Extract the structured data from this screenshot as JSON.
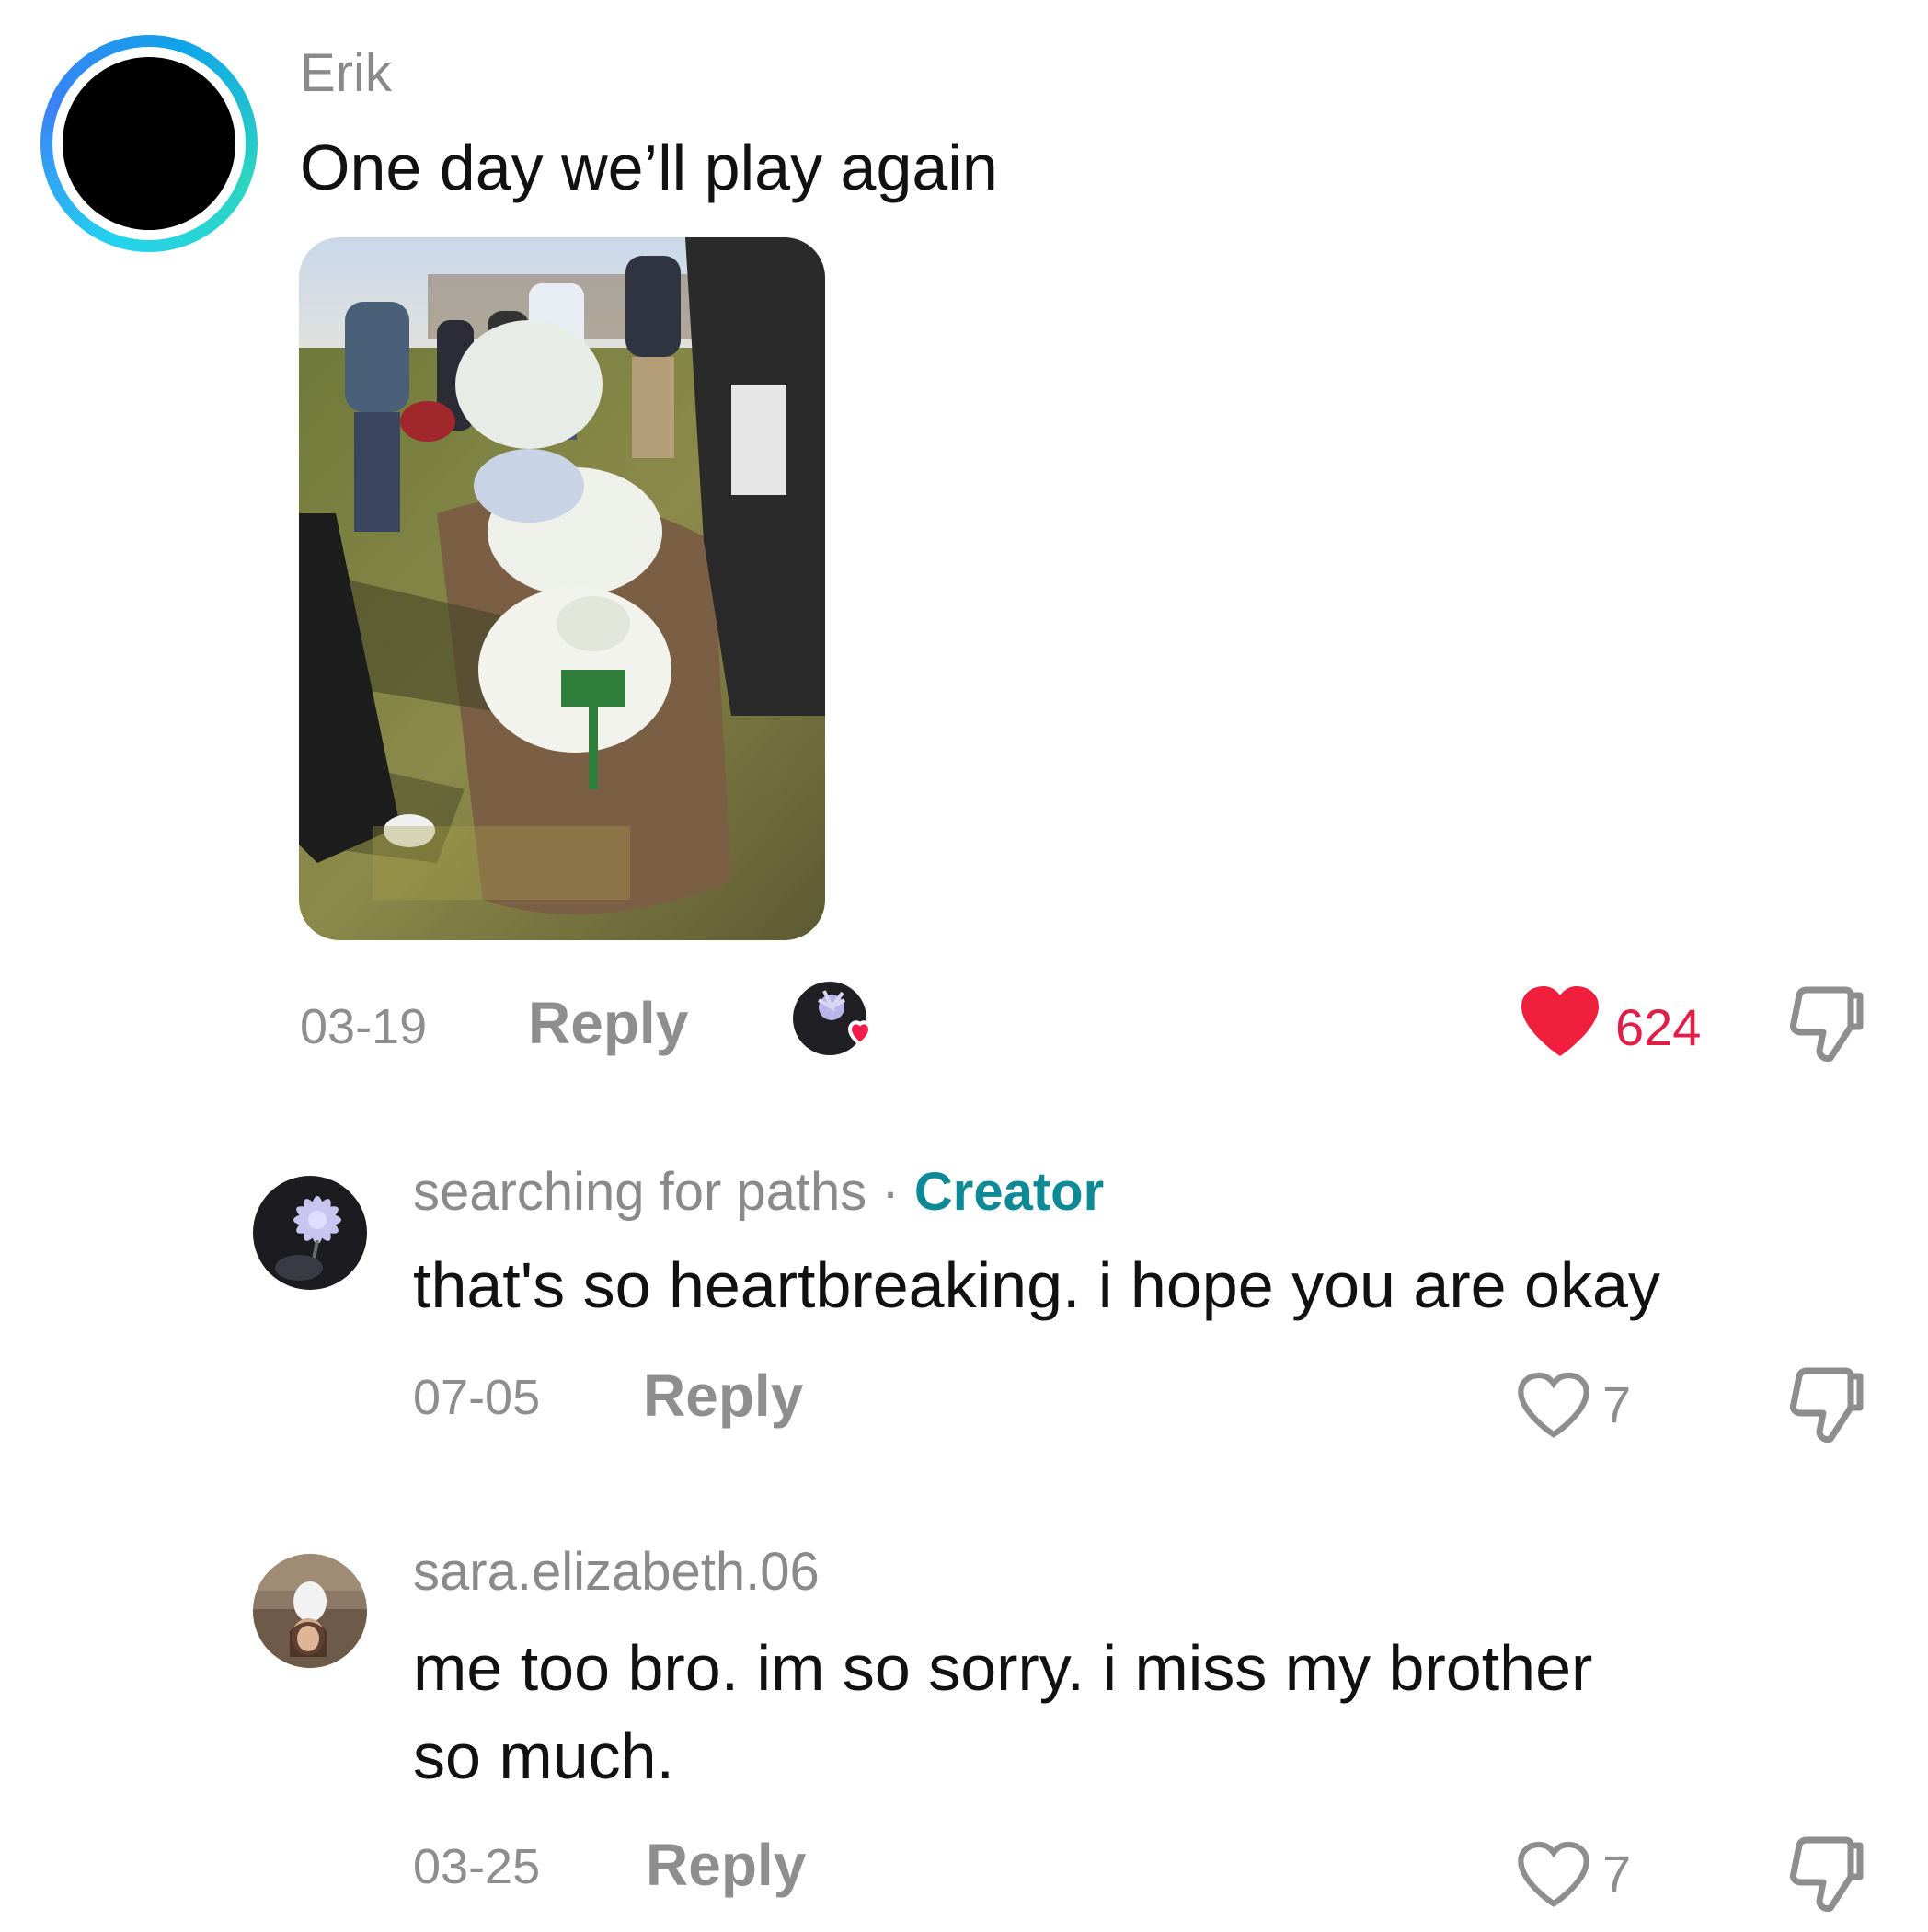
{
  "comments": [
    {
      "username": "Erik",
      "text": "One day we’ll play again",
      "date": "03-19",
      "reply_label": "Reply",
      "like_count": "624",
      "liked": true,
      "creator_liked": true
    },
    {
      "username": "searching for paths",
      "separator": "·",
      "badge": "Creator",
      "text": "that's so heartbreaking. i hope you are okay",
      "date": "07-05",
      "reply_label": "Reply",
      "like_count": "7",
      "liked": false
    },
    {
      "username": "sara.elizabeth.06",
      "text_line1": "me too bro. im so sorry. i miss my brother",
      "text_line2": "so much.",
      "date": "03-25",
      "reply_label": "Reply",
      "like_count": "7",
      "liked": false
    }
  ],
  "icons": {
    "like_filled": "heart-filled-icon",
    "like_outline": "heart-outline-icon",
    "dislike": "thumbs-down-icon"
  },
  "colors": {
    "like_red": "#e11d48",
    "creator_teal": "#0e8a96",
    "muted_gray": "#8e8e8e"
  }
}
